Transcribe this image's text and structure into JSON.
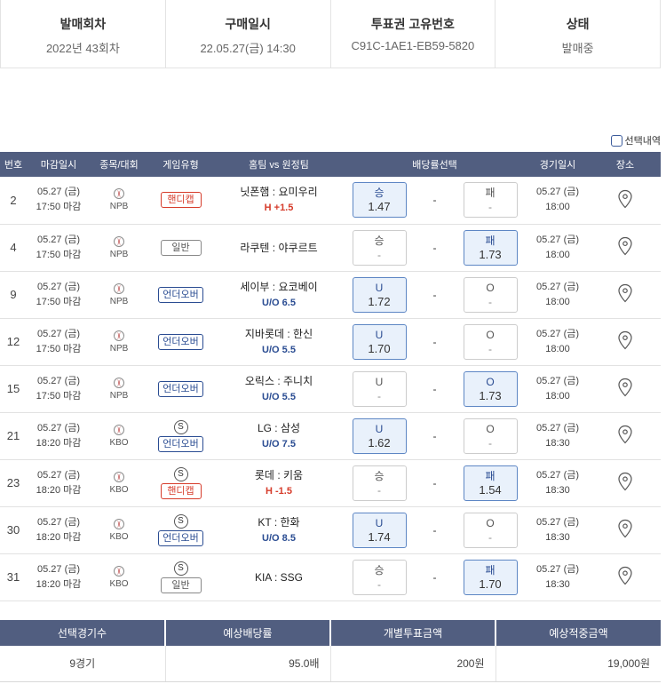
{
  "info": [
    {
      "label": "발매회차",
      "value": "2022년 43회차"
    },
    {
      "label": "구매일시",
      "value": "22.05.27(금) 14:30"
    },
    {
      "label": "투표권 고유번호",
      "value": "C91C-1AE1-EB59-5820"
    },
    {
      "label": "상태",
      "value": "발매중"
    }
  ],
  "select_label": "선택내역",
  "headers": {
    "no": "번호",
    "deadline": "마감일시",
    "sport": "종목/대회",
    "type": "게임유형",
    "match": "홈팀 vs 원정팀",
    "odds": "배당률선택",
    "gametime": "경기일시",
    "place": "장소"
  },
  "games": [
    {
      "no": "2",
      "d1": "05.27 (금)",
      "d2": "17:50 마감",
      "league": "NPB",
      "s": "",
      "type": "핸디캡",
      "type_class": "handicap",
      "home": "닛폰햄",
      "away": "요미우리",
      "sub": "H +1.5",
      "sub_color": "red",
      "o1_label": "승",
      "o1_val": "1.47",
      "o1_on": true,
      "mid": "-",
      "o2_label": "패",
      "o2_val": "-",
      "o2_on": false,
      "g1": "05.27 (금)",
      "g2": "18:00"
    },
    {
      "no": "4",
      "d1": "05.27 (금)",
      "d2": "17:50 마감",
      "league": "NPB",
      "s": "",
      "type": "일반",
      "type_class": "normal",
      "home": "라쿠텐",
      "away": "야쿠르트",
      "sub": "",
      "sub_color": "",
      "o1_label": "승",
      "o1_val": "-",
      "o1_on": false,
      "mid": "-",
      "o2_label": "패",
      "o2_val": "1.73",
      "o2_on": true,
      "g1": "05.27 (금)",
      "g2": "18:00"
    },
    {
      "no": "9",
      "d1": "05.27 (금)",
      "d2": "17:50 마감",
      "league": "NPB",
      "s": "",
      "type": "언더오버",
      "type_class": "uo",
      "home": "세이부",
      "away": "요코베이",
      "sub": "U/O 6.5",
      "sub_color": "blue",
      "o1_label": "U",
      "o1_val": "1.72",
      "o1_on": true,
      "mid": "-",
      "o2_label": "O",
      "o2_val": "-",
      "o2_on": false,
      "g1": "05.27 (금)",
      "g2": "18:00"
    },
    {
      "no": "12",
      "d1": "05.27 (금)",
      "d2": "17:50 마감",
      "league": "NPB",
      "s": "",
      "type": "언더오버",
      "type_class": "uo",
      "home": "지바롯데",
      "away": "한신",
      "sub": "U/O 5.5",
      "sub_color": "blue",
      "o1_label": "U",
      "o1_val": "1.70",
      "o1_on": true,
      "mid": "-",
      "o2_label": "O",
      "o2_val": "-",
      "o2_on": false,
      "g1": "05.27 (금)",
      "g2": "18:00"
    },
    {
      "no": "15",
      "d1": "05.27 (금)",
      "d2": "17:50 마감",
      "league": "NPB",
      "s": "",
      "type": "언더오버",
      "type_class": "uo",
      "home": "오릭스",
      "away": "주니치",
      "sub": "U/O 5.5",
      "sub_color": "blue",
      "o1_label": "U",
      "o1_val": "-",
      "o1_on": false,
      "mid": "-",
      "o2_label": "O",
      "o2_val": "1.73",
      "o2_on": true,
      "g1": "05.27 (금)",
      "g2": "18:00"
    },
    {
      "no": "21",
      "d1": "05.27 (금)",
      "d2": "18:20 마감",
      "league": "KBO",
      "s": "S",
      "type": "언더오버",
      "type_class": "uo",
      "home": "LG",
      "away": "삼성",
      "sub": "U/O 7.5",
      "sub_color": "blue",
      "o1_label": "U",
      "o1_val": "1.62",
      "o1_on": true,
      "mid": "-",
      "o2_label": "O",
      "o2_val": "-",
      "o2_on": false,
      "g1": "05.27 (금)",
      "g2": "18:30"
    },
    {
      "no": "23",
      "d1": "05.27 (금)",
      "d2": "18:20 마감",
      "league": "KBO",
      "s": "S",
      "type": "핸디캡",
      "type_class": "handicap",
      "home": "롯데",
      "away": "키움",
      "sub": "H -1.5",
      "sub_color": "red",
      "o1_label": "승",
      "o1_val": "-",
      "o1_on": false,
      "mid": "-",
      "o2_label": "패",
      "o2_val": "1.54",
      "o2_on": true,
      "g1": "05.27 (금)",
      "g2": "18:30"
    },
    {
      "no": "30",
      "d1": "05.27 (금)",
      "d2": "18:20 마감",
      "league": "KBO",
      "s": "S",
      "type": "언더오버",
      "type_class": "uo",
      "home": "KT",
      "away": "한화",
      "sub": "U/O 8.5",
      "sub_color": "blue",
      "o1_label": "U",
      "o1_val": "1.74",
      "o1_on": true,
      "mid": "-",
      "o2_label": "O",
      "o2_val": "-",
      "o2_on": false,
      "g1": "05.27 (금)",
      "g2": "18:30"
    },
    {
      "no": "31",
      "d1": "05.27 (금)",
      "d2": "18:20 마감",
      "league": "KBO",
      "s": "S",
      "type": "일반",
      "type_class": "normal",
      "home": "KIA",
      "away": "SSG",
      "sub": "",
      "sub_color": "",
      "o1_label": "승",
      "o1_val": "-",
      "o1_on": false,
      "mid": "-",
      "o2_label": "패",
      "o2_val": "1.70",
      "o2_on": true,
      "g1": "05.27 (금)",
      "g2": "18:30"
    }
  ],
  "summary": {
    "headers": [
      "선택경기수",
      "예상배당률",
      "개별투표금액",
      "예상적중금액"
    ],
    "values": [
      "9경기",
      "95.0배",
      "200원",
      "19,000원"
    ]
  },
  "colors": {
    "header_bg": "#515e80",
    "selected_bg": "#e9f1fb",
    "handicap": "#d63c2b",
    "under_over": "#2a4c92"
  }
}
